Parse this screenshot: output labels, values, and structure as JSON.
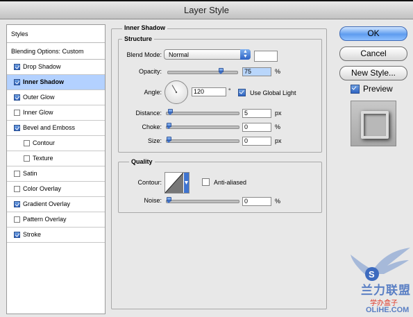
{
  "window": {
    "title": "Layer Style"
  },
  "styles_panel": {
    "header": "Styles",
    "blending_options": "Blending Options: Custom",
    "items": [
      {
        "label": "Drop Shadow",
        "checked": true,
        "active": false,
        "indent": false
      },
      {
        "label": "Inner Shadow",
        "checked": true,
        "active": true,
        "indent": false
      },
      {
        "label": "Outer Glow",
        "checked": true,
        "active": false,
        "indent": false
      },
      {
        "label": "Inner Glow",
        "checked": false,
        "active": false,
        "indent": false
      },
      {
        "label": "Bevel and Emboss",
        "checked": true,
        "active": false,
        "indent": false
      },
      {
        "label": "Contour",
        "checked": false,
        "active": false,
        "indent": true
      },
      {
        "label": "Texture",
        "checked": false,
        "active": false,
        "indent": true
      },
      {
        "label": "Satin",
        "checked": false,
        "active": false,
        "indent": false
      },
      {
        "label": "Color Overlay",
        "checked": false,
        "active": false,
        "indent": false
      },
      {
        "label": "Gradient Overlay",
        "checked": true,
        "active": false,
        "indent": false
      },
      {
        "label": "Pattern Overlay",
        "checked": false,
        "active": false,
        "indent": false
      },
      {
        "label": "Stroke",
        "checked": true,
        "active": false,
        "indent": false
      }
    ]
  },
  "inner_shadow": {
    "title": "Inner Shadow",
    "structure": {
      "title": "Structure",
      "blend_mode_label": "Blend Mode:",
      "blend_mode_value": "Normal",
      "shadow_color": "#ffffff",
      "opacity_label": "Opacity:",
      "opacity_value": "75",
      "opacity_unit": "%",
      "opacity_fraction": 0.75,
      "angle_label": "Angle:",
      "angle_value": "120",
      "angle_unit": "°",
      "angle_degrees": 120,
      "use_global_light_label": "Use Global Light",
      "use_global_light_checked": true,
      "distance_label": "Distance:",
      "distance_value": "5",
      "distance_unit": "px",
      "distance_fraction": 0.02,
      "choke_label": "Choke:",
      "choke_value": "0",
      "choke_unit": "%",
      "choke_fraction": 0,
      "size_label": "Size:",
      "size_value": "0",
      "size_unit": "px",
      "size_fraction": 0
    },
    "quality": {
      "title": "Quality",
      "contour_label": "Contour:",
      "anti_aliased_label": "Anti-aliased",
      "anti_aliased_checked": false,
      "noise_label": "Noise:",
      "noise_value": "0",
      "noise_unit": "%",
      "noise_fraction": 0
    }
  },
  "buttons": {
    "ok": "OK",
    "cancel": "Cancel",
    "new_style": "New Style...",
    "preview_label": "Preview",
    "preview_checked": true
  },
  "watermark": {
    "site": "OLiHE.COM",
    "brand_cn": "兰力联盟",
    "box_cn": "学办盒子"
  }
}
